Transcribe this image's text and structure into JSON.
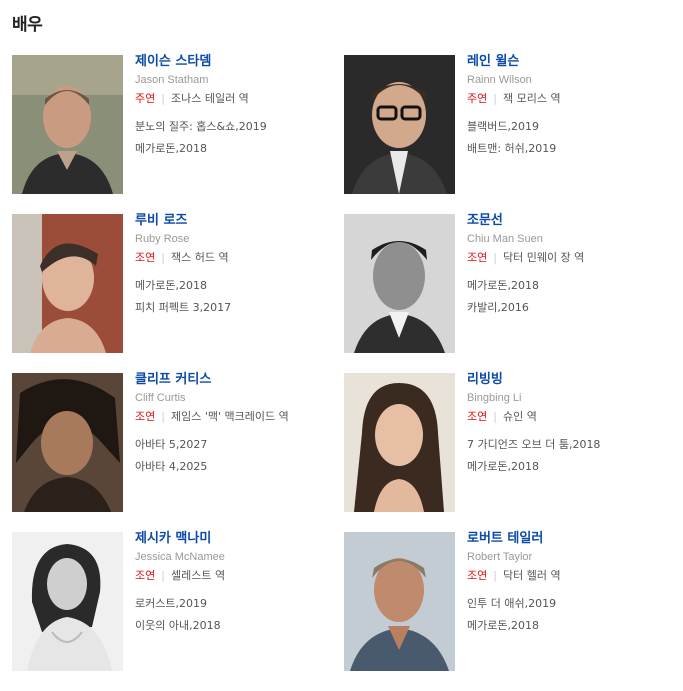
{
  "section_title": "배우",
  "actors": [
    {
      "name": "제이슨 스타뎀",
      "eng": "Jason Statham",
      "type": "주연",
      "role": "조나스 테일러 역",
      "works": [
        "분노의 질주: 홉스&쇼,2019",
        "메가로돈,2018"
      ]
    },
    {
      "name": "레인 윌슨",
      "eng": "Rainn Wilson",
      "type": "주연",
      "role": "잭 모리스 역",
      "works": [
        "블랙버드,2019",
        "배트맨: 허쉬,2019"
      ]
    },
    {
      "name": "루비 로즈",
      "eng": "Ruby Rose",
      "type": "조연",
      "role": "잭스 허드 역",
      "works": [
        "메가로돈,2018",
        "피치 퍼펙트 3,2017"
      ]
    },
    {
      "name": "조문선",
      "eng": "Chiu Man Suen",
      "type": "조연",
      "role": "닥터 민웨이 장 역",
      "works": [
        "메가로돈,2018",
        "카발리,2016"
      ]
    },
    {
      "name": "클리프 커티스",
      "eng": "Cliff Curtis",
      "type": "조연",
      "role": "제임스 '맥' 맥크레이드 역",
      "works": [
        "아바타 5,2027",
        "아바타 4,2025"
      ]
    },
    {
      "name": "리빙빙",
      "eng": "Bingbing Li",
      "type": "조연",
      "role": "슈인 역",
      "works": [
        "7 가디언즈 오브 더 툼,2018",
        "메가로돈,2018"
      ]
    },
    {
      "name": "제시카 맥나미",
      "eng": "Jessica McNamee",
      "type": "조연",
      "role": "셀레스트 역",
      "works": [
        "로커스트,2019",
        "이웃의 아내,2018"
      ]
    },
    {
      "name": "로버트 테일러",
      "eng": "Robert Taylor",
      "type": "조연",
      "role": "닥터 헬러 역",
      "works": [
        "인투 더 애쉬,2019",
        "메가로돈,2018"
      ]
    }
  ]
}
